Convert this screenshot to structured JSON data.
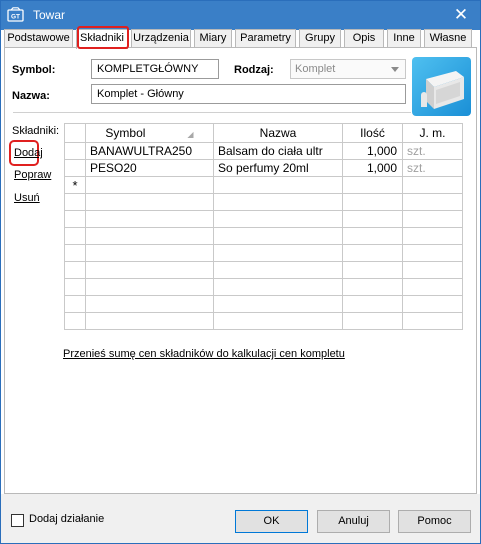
{
  "window": {
    "title": "Towar"
  },
  "tabs": [
    {
      "label": "Podstawowe"
    },
    {
      "label": "Składniki"
    },
    {
      "label": "Urządzenia"
    },
    {
      "label": "Miary"
    },
    {
      "label": "Parametry"
    },
    {
      "label": "Grupy"
    },
    {
      "label": "Opis"
    },
    {
      "label": "Inne"
    },
    {
      "label": "Własne"
    }
  ],
  "active_tab": "Składniki",
  "form": {
    "symbol_label": "Symbol:",
    "symbol_value": "KOMPLETGŁÓWNY",
    "rodzaj_label": "Rodzaj:",
    "rodzaj_value": "Komplet",
    "nazwa_label": "Nazwa:",
    "nazwa_value": "Komplet - Główny"
  },
  "side": {
    "label": "Składniki:",
    "add": "Dodaj",
    "edit": "Popraw",
    "delete": "Usuń"
  },
  "table": {
    "columns": [
      "Symbol",
      "Nazwa",
      "Ilość",
      "J. m."
    ],
    "rows": [
      {
        "symbol": "BANAWULTRA250",
        "nazwa": "Balsam do ciała ultr",
        "ilosc": "1,000",
        "jm": "szt."
      },
      {
        "symbol": "PESO20",
        "nazwa": "So perfumy 20ml",
        "ilosc": "1,000",
        "jm": "szt."
      }
    ],
    "new_row_marker": "*"
  },
  "link": {
    "transfer": "Przenieś sumę cen składników do kalkulacji cen kompletu"
  },
  "footer": {
    "checkbox_label": "Dodaj działanie",
    "ok": "OK",
    "cancel": "Anuluj",
    "help": "Pomoc"
  },
  "colors": {
    "titlebar": "#3a7fc7",
    "highlight": "#e0201f"
  }
}
